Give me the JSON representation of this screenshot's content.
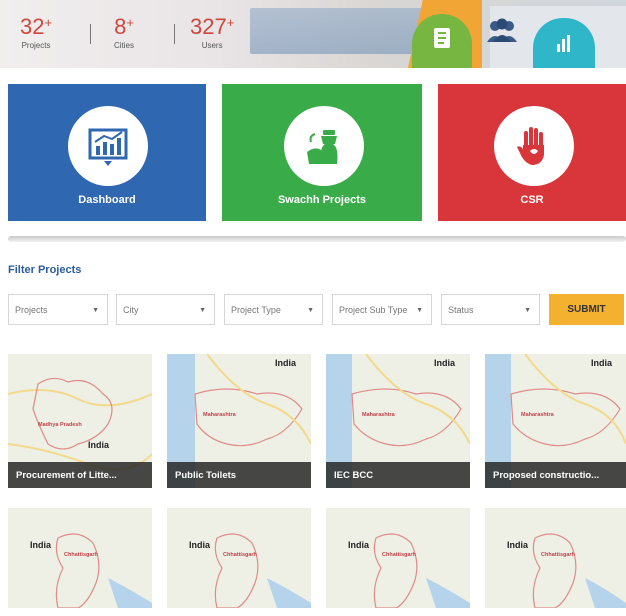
{
  "stats": [
    {
      "value": "32",
      "suffix": "+",
      "label": "Projects"
    },
    {
      "value": "8",
      "suffix": "+",
      "label": "Cities"
    },
    {
      "value": "327",
      "suffix": "+",
      "label": "Users"
    }
  ],
  "tiles": [
    {
      "label": "Dashboard",
      "icon": "chart-icon"
    },
    {
      "label": "Swachh Projects",
      "icon": "cleaning-icon"
    },
    {
      "label": "CSR",
      "icon": "hand-icon"
    }
  ],
  "filter": {
    "title": "Filter Projects",
    "selects": [
      {
        "label": "Projects"
      },
      {
        "label": "City"
      },
      {
        "label": "Project Type"
      },
      {
        "label": "Project Sub Type"
      },
      {
        "label": "Status"
      }
    ],
    "submit_label": "SUBMIT"
  },
  "cards": [
    {
      "title": "Procurement of Litte...",
      "map": "Madhya Pradesh",
      "place": "India"
    },
    {
      "title": "Public Toilets",
      "map": "Maharashtra",
      "place": "India"
    },
    {
      "title": "IEC BCC",
      "map": "Maharashtra",
      "place": "India"
    },
    {
      "title": "Proposed constructio...",
      "map": "Maharashtra",
      "place": "India"
    },
    {
      "title": "",
      "map": "Chhattisgarh",
      "place": "India"
    },
    {
      "title": "",
      "map": "Chhattisgarh",
      "place": "India"
    },
    {
      "title": "",
      "map": "Chhattisgarh",
      "place": "India"
    },
    {
      "title": "",
      "map": "Chhattisgarh",
      "place": "India"
    }
  ],
  "colors": {
    "dashboard": "#2f67b1",
    "swachh": "#3aab49",
    "csr": "#d8363a",
    "submit": "#f3b12f",
    "stat_number": "#d1463d"
  }
}
